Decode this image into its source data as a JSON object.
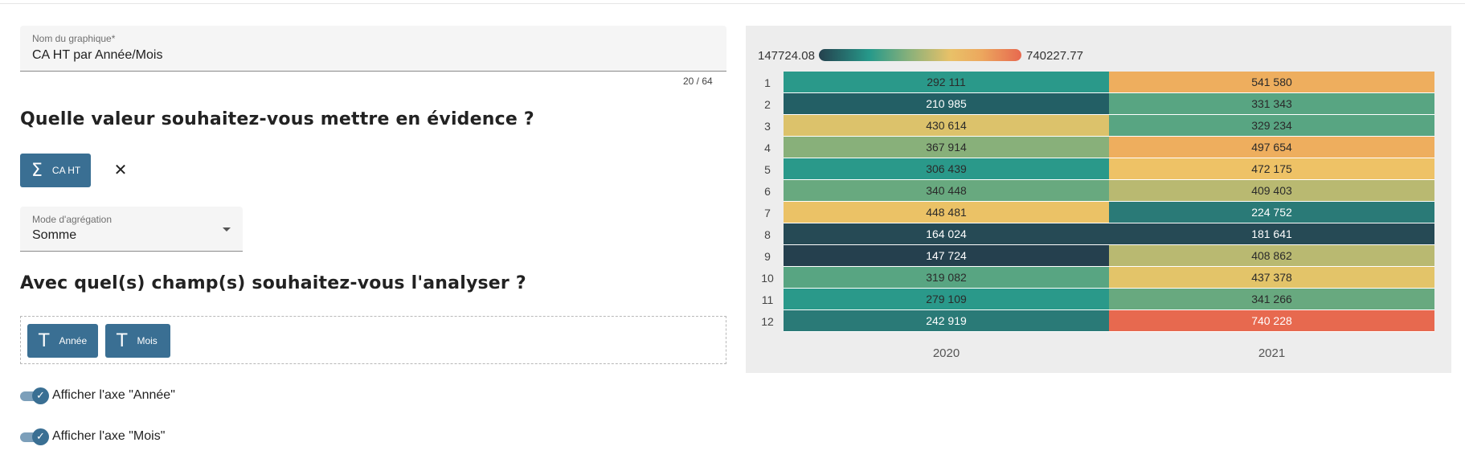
{
  "form": {
    "name_label": "Nom du graphique*",
    "name_value": "CA HT par Année/Mois",
    "name_counter": "20 / 64",
    "heading_value": "Quelle valeur souhaitez-vous mettre en évidence ?",
    "value_chip": {
      "icon": "sigma-icon",
      "glyph": "Σ",
      "label": "CA HT"
    },
    "remove_glyph": "✕",
    "aggregation_label": "Mode d'agrégation",
    "aggregation_value": "Somme",
    "heading_fields": "Avec quel(s) champ(s) souhaitez-vous l'analyser ?",
    "field_chips": [
      {
        "icon": "text-field-icon",
        "glyph": "T",
        "label": "Année"
      },
      {
        "icon": "text-field-icon",
        "glyph": "T",
        "label": "Mois"
      }
    ],
    "toggles": [
      {
        "label": "Afficher l'axe \"Année\"",
        "checked": true,
        "check_glyph": "✓"
      },
      {
        "label": "Afficher l'axe \"Mois\"",
        "checked": true,
        "check_glyph": "✓"
      }
    ]
  },
  "chart_data": {
    "type": "heatmap",
    "legend": {
      "min": "147724.08",
      "max": "740227.77",
      "min_value": 147724.08,
      "max_value": 740227.77
    },
    "x_categories": [
      "2020",
      "2021"
    ],
    "y_categories": [
      "1",
      "2",
      "3",
      "4",
      "5",
      "6",
      "7",
      "8",
      "9",
      "10",
      "11",
      "12"
    ],
    "labels": [
      [
        "292 111",
        "541 580"
      ],
      [
        "210 985",
        "331 343"
      ],
      [
        "430 614",
        "329 234"
      ],
      [
        "367 914",
        "497 654"
      ],
      [
        "306 439",
        "472 175"
      ],
      [
        "340 448",
        "409 403"
      ],
      [
        "448 481",
        "224 752"
      ],
      [
        "164 024",
        "181 641"
      ],
      [
        "147 724",
        "408 862"
      ],
      [
        "319 082",
        "437 378"
      ],
      [
        "279 109",
        "341 266"
      ],
      [
        "242 919",
        "740 228"
      ]
    ],
    "values": [
      [
        292111,
        541580
      ],
      [
        210985,
        331343
      ],
      [
        430614,
        329234
      ],
      [
        367914,
        497654
      ],
      [
        306439,
        472175
      ],
      [
        340448,
        409403
      ],
      [
        448481,
        224752
      ],
      [
        164024,
        181641
      ],
      [
        147724,
        408862
      ],
      [
        319082,
        437378
      ],
      [
        279109,
        341266
      ],
      [
        242919,
        740228
      ]
    ],
    "colors": [
      [
        "#2a998a",
        "#eeae5e"
      ],
      [
        "#235f65",
        "#58a582"
      ],
      [
        "#dcc26b",
        "#58a582"
      ],
      [
        "#88b07a",
        "#eeae5e"
      ],
      [
        "#2a998a",
        "#eec266"
      ],
      [
        "#68a97f",
        "#b9b971"
      ],
      [
        "#ebc266",
        "#2a7a77"
      ],
      [
        "#264a55",
        "#264a55"
      ],
      [
        "#25404e",
        "#b9b971"
      ],
      [
        "#58a582",
        "#e3c469"
      ],
      [
        "#2a998a",
        "#68a97f"
      ],
      [
        "#2a7a77",
        "#e7694f"
      ]
    ]
  }
}
